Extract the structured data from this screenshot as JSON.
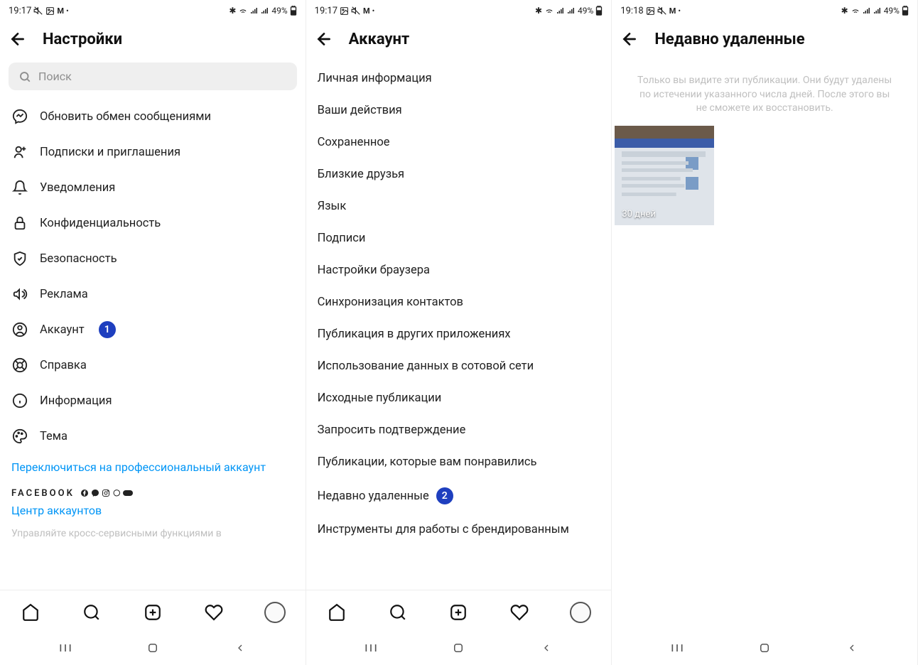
{
  "screens": {
    "settings": {
      "status": {
        "time": "19:17",
        "battery": "49%"
      },
      "title": "Настройки",
      "search_placeholder": "Поиск",
      "items": [
        {
          "label": "Обновить обмен сообщениями"
        },
        {
          "label": "Подписки и приглашения"
        },
        {
          "label": "Уведомления"
        },
        {
          "label": "Конфиденциальность"
        },
        {
          "label": "Безопасность"
        },
        {
          "label": "Реклама"
        },
        {
          "label": "Аккаунт",
          "badge": "1"
        },
        {
          "label": "Справка"
        },
        {
          "label": "Информация"
        },
        {
          "label": "Тема"
        }
      ],
      "switch_pro": "Переключиться на профессиональный аккаунт",
      "facebook_label": "FACEBOOK",
      "accounts_center": "Центр аккаунтов",
      "muted": "Управляйте кросс-сервисными функциями в"
    },
    "account": {
      "status": {
        "time": "19:17",
        "battery": "49%"
      },
      "title": "Аккаунт",
      "items": [
        "Личная информация",
        "Ваши действия",
        "Сохраненное",
        "Близкие друзья",
        "Язык",
        "Подписи",
        "Настройки браузера",
        "Синхронизация контактов",
        "Публикация в других приложениях",
        "Использование данных в сотовой сети",
        "Исходные публикации",
        "Запросить подтверждение",
        "Публикации, которые вам понравились",
        "Недавно удаленные",
        "Инструменты для работы с брендированным"
      ],
      "badge_index": 13,
      "badge": "2"
    },
    "deleted": {
      "status": {
        "time": "19:18",
        "battery": "49%"
      },
      "title": "Недавно удаленные",
      "info": "Только вы видите эти публикации. Они будут удалены по истечении указанного числа дней. После этого вы не сможете их восстановить.",
      "thumb_days": "30 дней"
    }
  }
}
